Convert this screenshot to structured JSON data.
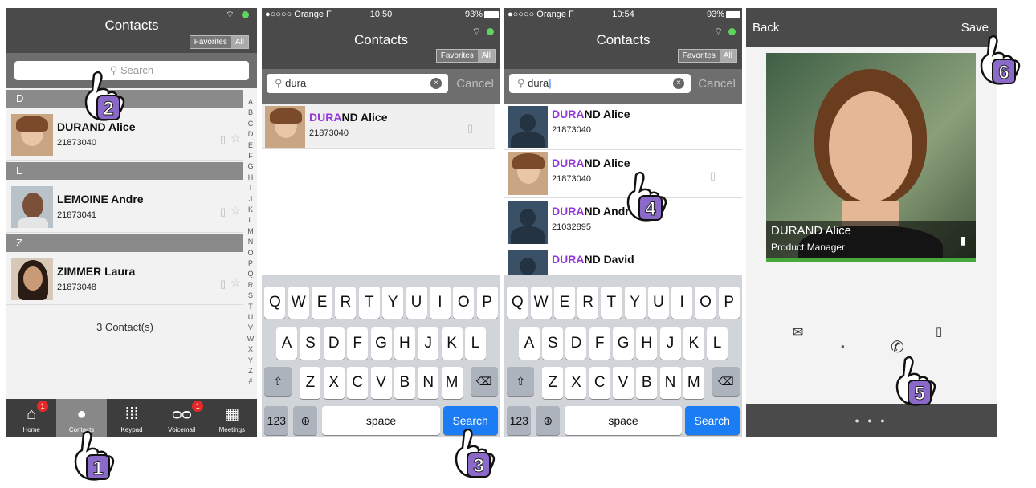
{
  "panel1": {
    "title": "Contacts",
    "seg": [
      "Favorites",
      "All"
    ],
    "search_placeholder": "Search",
    "sections": [
      "D",
      "L",
      "Z"
    ],
    "contacts": [
      {
        "name": "DURAND Alice",
        "number": "21873040"
      },
      {
        "name": "LEMOINE Andre",
        "number": "21873041"
      },
      {
        "name": "ZIMMER Laura",
        "number": "21873048"
      }
    ],
    "count_text": "3 Contact(s)",
    "alphabet": [
      "A",
      "B",
      "C",
      "D",
      "E",
      "F",
      "G",
      "H",
      "I",
      "J",
      "K",
      "L",
      "M",
      "N",
      "O",
      "P",
      "Q",
      "R",
      "S",
      "T",
      "U",
      "V",
      "W",
      "X",
      "Y",
      "Z",
      "#"
    ],
    "tabs": [
      {
        "label": "Home",
        "icon": "home-icon",
        "badge": "1"
      },
      {
        "label": "Contacts",
        "icon": "person-icon",
        "badge": ""
      },
      {
        "label": "Keypad",
        "icon": "keypad-icon",
        "badge": ""
      },
      {
        "label": "Voicemail",
        "icon": "voicemail-icon",
        "badge": "1"
      },
      {
        "label": "Meetings",
        "icon": "calendar-icon",
        "badge": ""
      }
    ]
  },
  "panel2": {
    "carrier": "●○○○○ Orange F",
    "time": "10:50",
    "battery": "93%",
    "title": "Contacts",
    "seg": [
      "Favorites",
      "All"
    ],
    "search_value": "dura",
    "cancel": "Cancel",
    "results": [
      {
        "match": "DURA",
        "rest": "ND Alice",
        "number": "21873040"
      }
    ]
  },
  "panel3": {
    "carrier": "●○○○○ Orange F",
    "time": "10:54",
    "battery": "93%",
    "title": "Contacts",
    "seg": [
      "Favorites",
      "All"
    ],
    "search_value": "dura",
    "cancel": "Cancel",
    "results": [
      {
        "match": "DURA",
        "rest": "ND Alice",
        "number": "21873040"
      },
      {
        "match": "DURA",
        "rest": "ND Alice",
        "number": "21873040"
      },
      {
        "match": "DURA",
        "rest": "ND Andre",
        "number": "21032895"
      },
      {
        "match": "DURA",
        "rest": "ND David",
        "number": ""
      }
    ]
  },
  "keyboard": {
    "row1": [
      "Q",
      "W",
      "E",
      "R",
      "T",
      "Y",
      "U",
      "I",
      "O",
      "P"
    ],
    "row2": [
      "A",
      "S",
      "D",
      "F",
      "G",
      "H",
      "J",
      "K",
      "L"
    ],
    "row3": [
      "Z",
      "X",
      "C",
      "V",
      "B",
      "N",
      "M"
    ],
    "numbers": "123",
    "space": "space",
    "search": "Search"
  },
  "panel4": {
    "back": "Back",
    "save": "Save",
    "name": "DURAND Alice",
    "role": "Product Manager",
    "page_dots": "● ● ●"
  },
  "steps": [
    "1",
    "2",
    "3",
    "4",
    "5",
    "6"
  ],
  "colors": {
    "accent": "#9438d8",
    "header": "#4a4a4a",
    "ios_blue": "#1b7cf3",
    "green": "#5fd35f"
  }
}
